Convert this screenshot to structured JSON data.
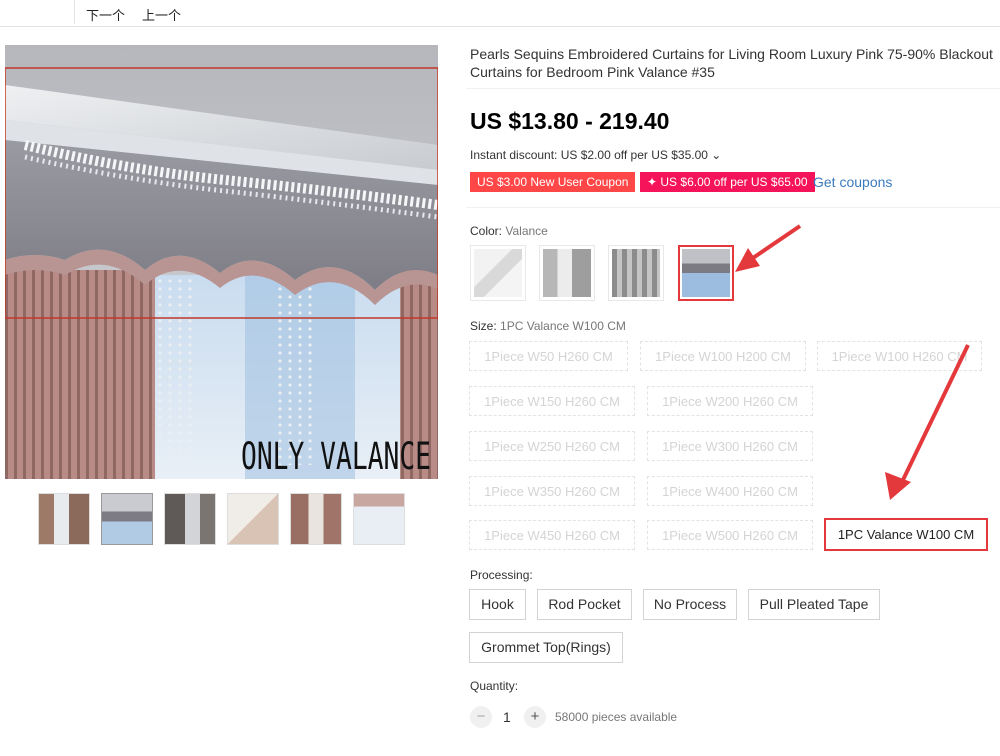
{
  "topbar": {
    "next_label": "下一个",
    "prev_label": "上一个"
  },
  "main_image": {
    "overlay_text": "ONLY VALANCE"
  },
  "product": {
    "title": "Pearls Sequins Embroidered Curtains for Living Room Luxury Pink 75-90% Blackout Curtains for Bedroom Pink Valance #35",
    "price": "US $13.80 - 219.40",
    "instant_discount": "Instant discount: US $2.00 off per US $35.00 ⌄",
    "coupon_new_user": "US $3.00 New User Coupon",
    "coupon_store": "✦ US $6.00 off per US $65.00",
    "get_coupons": "Get coupons"
  },
  "color": {
    "label": "Color:",
    "selected": "Valance"
  },
  "size": {
    "label": "Size:",
    "selected": "1PC Valance W100 CM",
    "options": [
      "1Piece W50 H260 CM",
      "1Piece W100 H200 CM",
      "1Piece W100 H260 CM",
      "1Piece W150 H260 CM",
      "1Piece W200 H260 CM",
      "1Piece W250 H260 CM",
      "1Piece W300 H260 CM",
      "1Piece W350 H260 CM",
      "1Piece W400 H260 CM",
      "1Piece W450 H260 CM",
      "1Piece W500 H260 CM",
      "1PC Valance W100 CM"
    ]
  },
  "processing": {
    "label": "Processing:",
    "options": [
      "Hook",
      "Rod Pocket",
      "No Process",
      "Pull Pleated Tape",
      "Grommet Top(Rings)"
    ]
  },
  "quantity": {
    "label": "Quantity:",
    "value": "1",
    "minus": "−",
    "plus": "+",
    "available": "58000 pieces available"
  },
  "colors": {
    "sale_red": "#ff4747",
    "coupon_pink": "#f5145a",
    "select_red": "#e4393c",
    "link_blue": "#3b7bbf"
  }
}
